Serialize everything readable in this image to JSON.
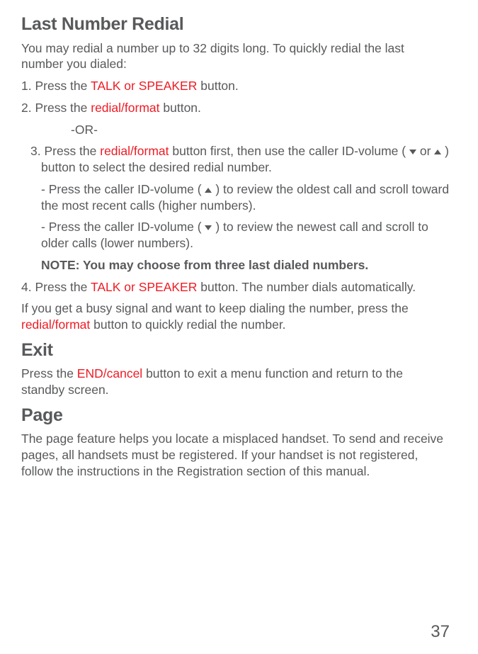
{
  "section1": {
    "heading": "Last Number Redial",
    "intro": "You may redial a number up to 32 digits long. To quickly redial the last number you dialed:",
    "step1_a": "1. Press the ",
    "step1_red": "TALK or SPEAKER",
    "step1_b": " button.",
    "step2_a": "2. Press the ",
    "step2_red": "redial/format",
    "step2_b": " button.",
    "or": "-OR-",
    "step3_a": "3. Press the ",
    "step3_red": "redial/format",
    "step3_b": " button first, then use the caller ID-volume ( ",
    "step3_or": " or ",
    "step3_c": " ) button to select the desired redial number.",
    "step3_sub1_a": "- Press the caller ID-volume ( ",
    "step3_sub1_b": " ) to review the oldest call and scroll toward the most recent calls (higher numbers).",
    "step3_sub2_a": "- Press the caller ID-volume ( ",
    "step3_sub2_b": " ) to review the newest call and scroll to older calls (lower numbers).",
    "note": "NOTE: You may choose from three last dialed numbers.",
    "step4_a": "4. Press the ",
    "step4_red": "TALK or SPEAKER",
    "step4_b": " button. The number dials automatically.",
    "footer_a": "If you get a busy signal and want to keep dialing the number, press the ",
    "footer_red": "redial/format",
    "footer_b": " button to quickly redial the number."
  },
  "section2": {
    "heading": "Exit",
    "body_a": "Press the ",
    "body_red": "END/cancel",
    "body_b": " button to exit a menu function and return to the standby screen."
  },
  "section3": {
    "heading": "Page",
    "body": "The page feature helps you locate a misplaced handset. To send and receive pages, all handsets must be registered. If your handset is not registered, follow the instructions in the Registration section of this manual."
  },
  "pageNumber": "37"
}
